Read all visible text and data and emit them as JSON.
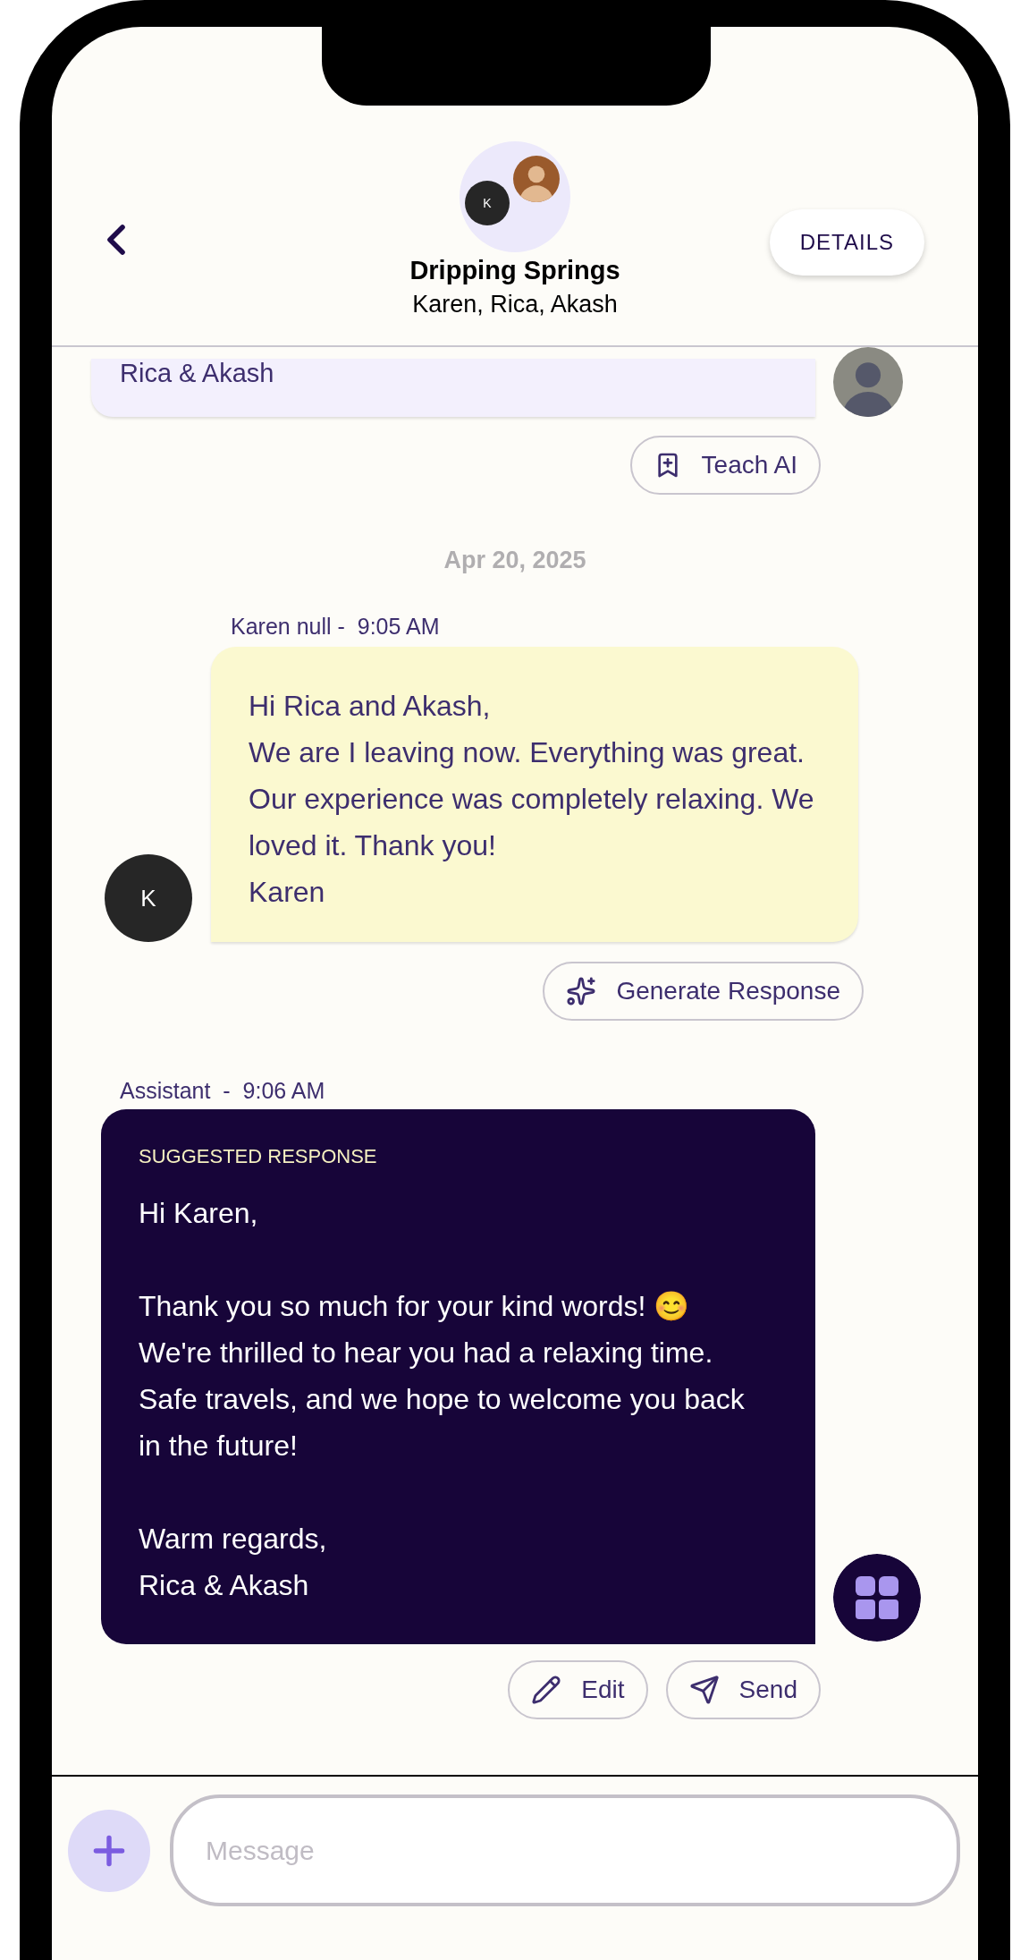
{
  "header": {
    "title": "Dripping Springs",
    "subtitle": "Karen, Rica, Akash",
    "group_initial": "K",
    "details_button": "DETAILS"
  },
  "messages": [
    {
      "kind": "host",
      "text": "Rica & Akash",
      "action": "Teach AI"
    },
    {
      "kind": "date",
      "text": "Apr 20, 2025"
    },
    {
      "kind": "guest",
      "meta": "Karen null -  9:05 AM",
      "initial": "K",
      "text": "Hi Rica and Akash,\nWe are I leaving now. Everything was great. Our experience was completely relaxing. We loved it. Thank you!\nKaren",
      "action": "Generate Response"
    },
    {
      "kind": "suggestion",
      "meta": "Assistant  -  9:06 AM",
      "label": "SUGGESTED RESPONSE",
      "text": "Hi Karen,\n\nThank you so much for your kind words! 😊 We're thrilled to hear you had a relaxing time. Safe travels, and we hope to welcome you back in the future!\n\nWarm regards,\nRica & Akash",
      "actions": [
        {
          "kind": "edit",
          "label": "Edit"
        },
        {
          "kind": "send",
          "label": "Send"
        }
      ]
    }
  ],
  "composer": {
    "placeholder": "Message"
  }
}
